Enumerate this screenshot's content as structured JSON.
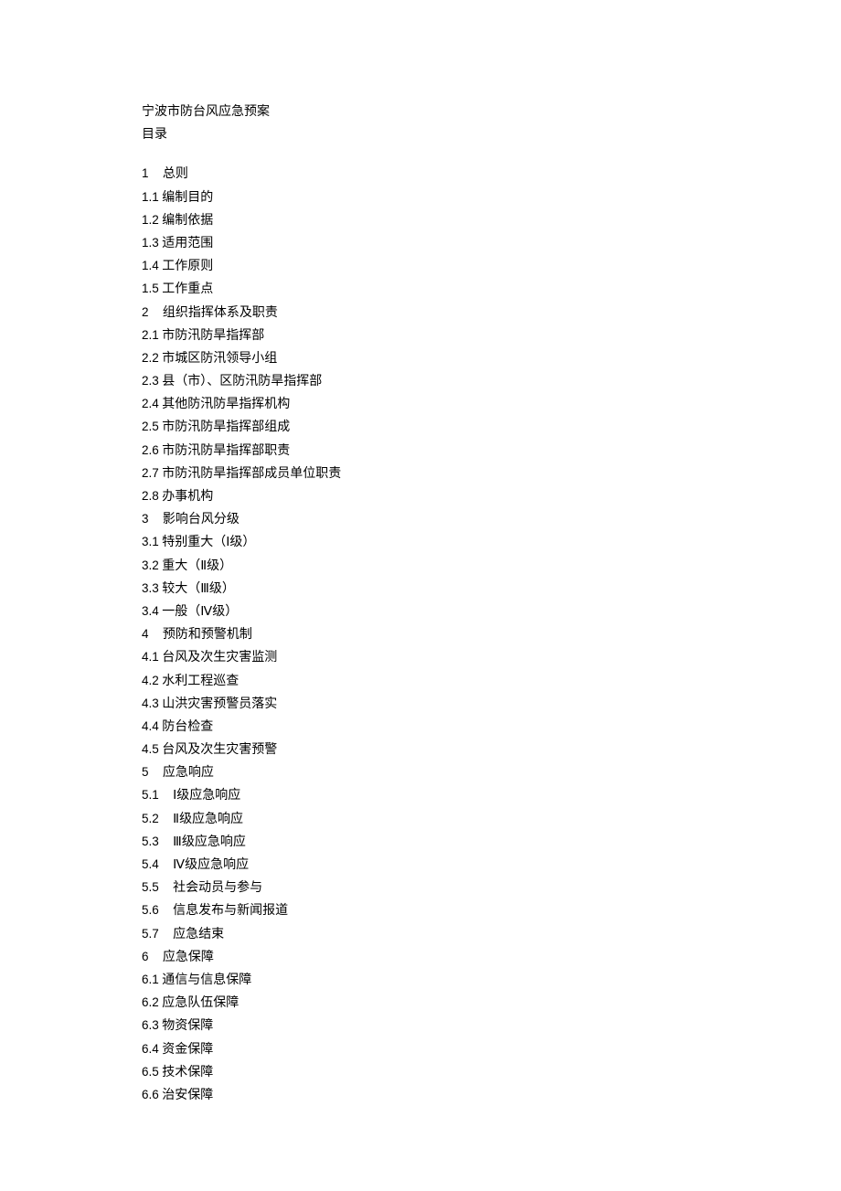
{
  "header": {
    "title": "宁波市防台风应急预案",
    "subtitle": "目录"
  },
  "lines": [
    {
      "num": "1",
      "text": "总则",
      "wide": true
    },
    {
      "num": "1.1",
      "text": "编制目的"
    },
    {
      "num": "1.2",
      "text": "编制依据"
    },
    {
      "num": "1.3",
      "text": "适用范围"
    },
    {
      "num": "1.4",
      "text": "工作原则"
    },
    {
      "num": "1.5",
      "text": "工作重点"
    },
    {
      "num": "2",
      "text": "组织指挥体系及职责",
      "wide": true
    },
    {
      "num": "2.1",
      "text": "市防汛防旱指挥部"
    },
    {
      "num": "2.2",
      "text": "市城区防汛领导小组"
    },
    {
      "num": "2.3",
      "text": "县（市）、区防汛防旱指挥部"
    },
    {
      "num": "2.4",
      "text": "其他防汛防旱指挥机构"
    },
    {
      "num": "2.5",
      "text": "市防汛防旱指挥部组成"
    },
    {
      "num": "2.6",
      "text": "市防汛防旱指挥部职责"
    },
    {
      "num": "2.7",
      "text": "市防汛防旱指挥部成员单位职责"
    },
    {
      "num": "2.8",
      "text": "办事机构"
    },
    {
      "num": "3",
      "text": "影响台风分级",
      "wide": true
    },
    {
      "num": "3.1",
      "text": "特别重大（Ⅰ级）"
    },
    {
      "num": "3.2",
      "text": "重大（Ⅱ级）"
    },
    {
      "num": "3.3",
      "text": "较大（Ⅲ级）"
    },
    {
      "num": "3.4",
      "text": "一般（Ⅳ级）"
    },
    {
      "num": "4",
      "text": "预防和预警机制",
      "wide": true
    },
    {
      "num": "4.1",
      "text": "台风及次生灾害监测"
    },
    {
      "num": "4.2",
      "text": "水利工程巡查"
    },
    {
      "num": "4.3",
      "text": "山洪灾害预警员落实"
    },
    {
      "num": "4.4",
      "text": "防台检查"
    },
    {
      "num": "4.5",
      "text": "台风及次生灾害预警"
    },
    {
      "num": "5",
      "text": "应急响应",
      "wide": true
    },
    {
      "num": "5.1",
      "text": "Ⅰ级应急响应",
      "pad": true
    },
    {
      "num": "5.2",
      "text": "Ⅱ级应急响应",
      "pad": true
    },
    {
      "num": "5.3",
      "text": "Ⅲ级应急响应",
      "pad": true
    },
    {
      "num": "5.4",
      "text": "Ⅳ级应急响应",
      "pad": true
    },
    {
      "num": "5.5",
      "text": "社会动员与参与",
      "pad": true
    },
    {
      "num": "5.6",
      "text": "信息发布与新闻报道",
      "pad": true
    },
    {
      "num": "5.7",
      "text": "应急结束",
      "pad": true
    },
    {
      "num": "6",
      "text": "应急保障",
      "wide": true
    },
    {
      "num": "6.1",
      "text": "通信与信息保障"
    },
    {
      "num": "6.2",
      "text": "应急队伍保障"
    },
    {
      "num": "6.3",
      "text": "物资保障"
    },
    {
      "num": "6.4",
      "text": "资金保障"
    },
    {
      "num": "6.5",
      "text": "技术保障"
    },
    {
      "num": "6.6",
      "text": "治安保障"
    }
  ]
}
